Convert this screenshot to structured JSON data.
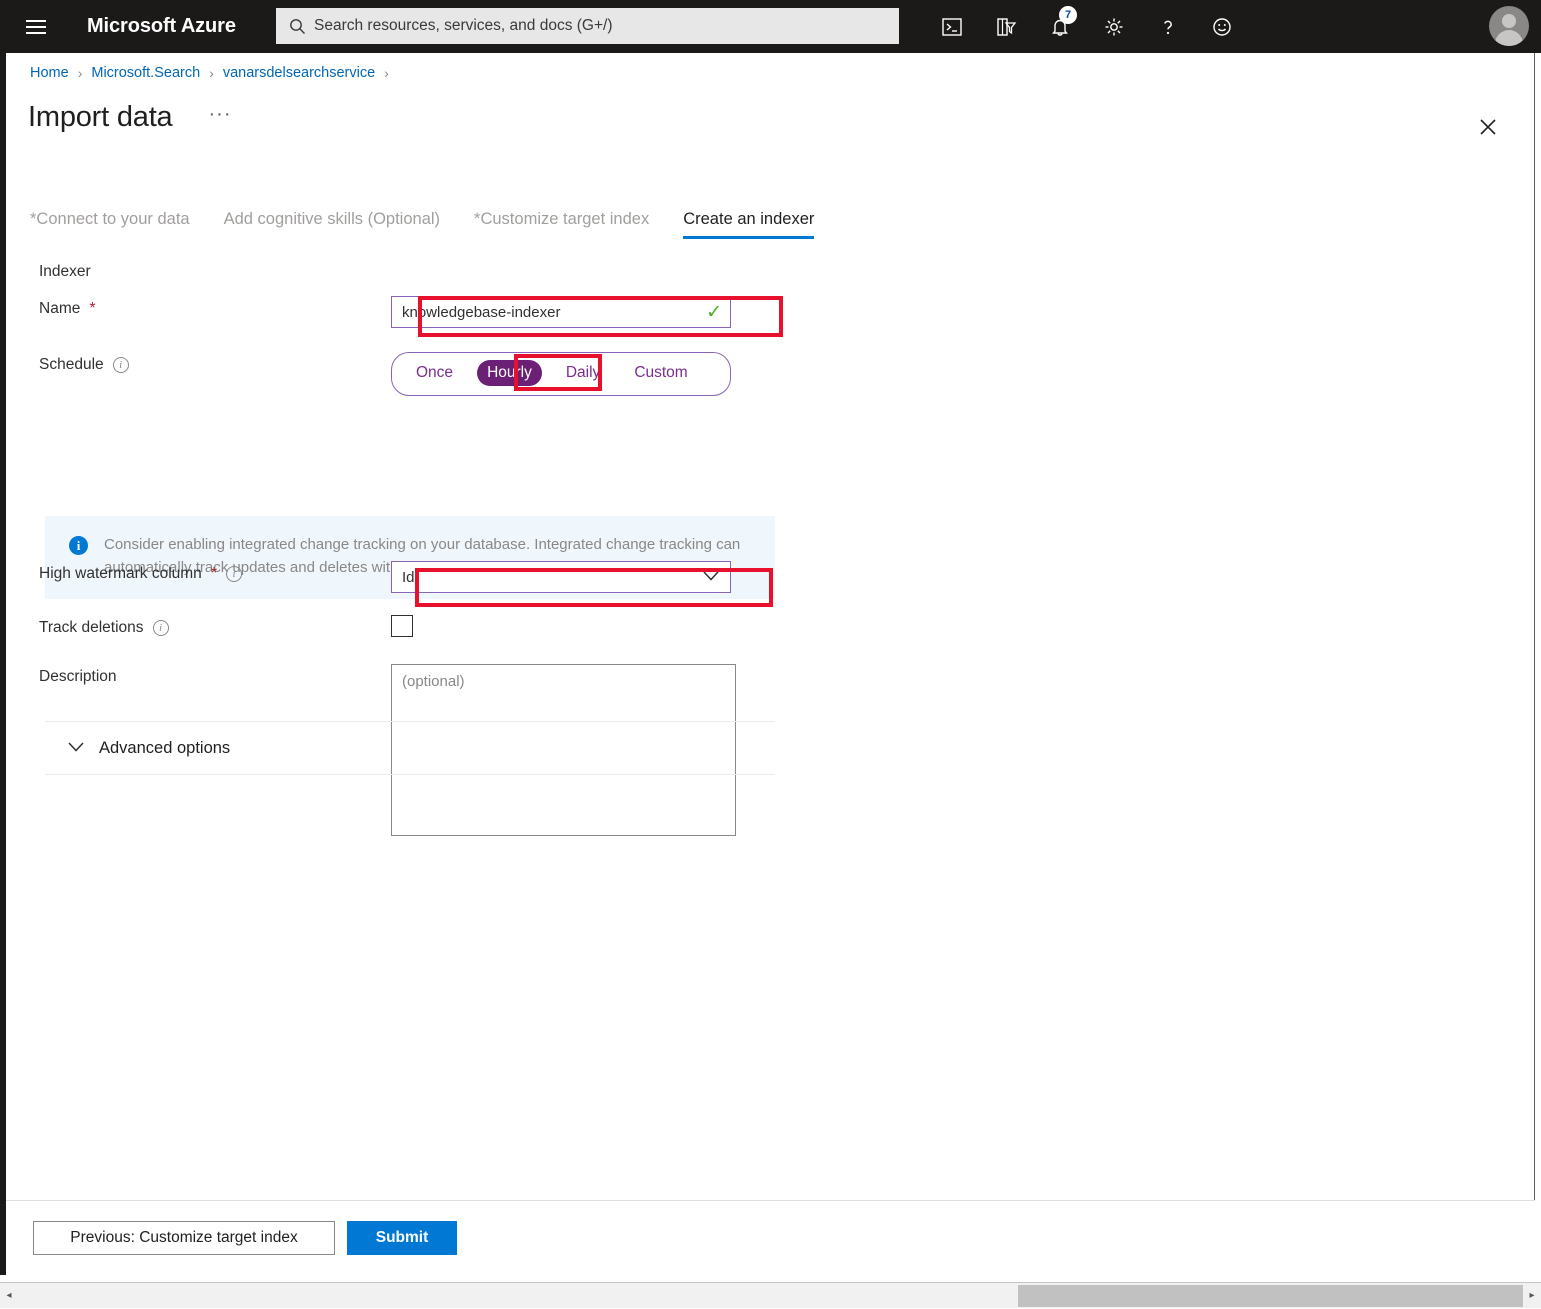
{
  "topbar": {
    "menu_icon": "hamburger-menu-icon",
    "brand": "Microsoft Azure",
    "search_placeholder": "Search resources, services, and docs (G+/)",
    "search_value": "",
    "search_icon": "search-icon",
    "icons": [
      {
        "name": "cloud-shell-icon",
        "glyph": ">_"
      },
      {
        "name": "directory-filter-icon",
        "glyph": ""
      },
      {
        "name": "notifications-bell-icon",
        "glyph": "",
        "badge": "7"
      },
      {
        "name": "settings-gear-icon",
        "glyph": ""
      },
      {
        "name": "help-question-icon",
        "glyph": "?"
      },
      {
        "name": "feedback-smiley-icon",
        "glyph": ""
      }
    ],
    "avatar": "user-avatar"
  },
  "breadcrumb": {
    "items": [
      "Home",
      "Microsoft.Search",
      "vanarsdelsearchservice"
    ],
    "separator": "›",
    "trailing_separator": "›"
  },
  "blade": {
    "title": "Import data",
    "ellipsis": "···",
    "close_label": "✕"
  },
  "tabs": [
    {
      "label": "Connect to your data",
      "required": true,
      "active": false
    },
    {
      "label": "Add cognitive skills (Optional)",
      "required": false,
      "active": false
    },
    {
      "label": "Customize target index",
      "required": true,
      "active": false
    },
    {
      "label": "Create an indexer",
      "required": false,
      "active": true
    }
  ],
  "form": {
    "section_label": "Indexer",
    "name": {
      "label": "Name",
      "required_mark": "*",
      "value": "knowledgebase-indexer",
      "valid_icon": "✓"
    },
    "schedule": {
      "label": "Schedule",
      "info_icon": "i",
      "options": [
        "Once",
        "Hourly",
        "Daily",
        "Custom"
      ],
      "selected": "Hourly"
    },
    "info_banner": {
      "icon": "info-icon",
      "text": "Consider enabling integrated change tracking on your database. Integrated change tracking can automatically track updates and deletes without using marker columns."
    },
    "high_watermark": {
      "label": "High watermark column",
      "required_mark": "*",
      "info_icon": "i",
      "value": "Id",
      "chevron": "⌄"
    },
    "track_deletions": {
      "label": "Track deletions",
      "info_icon": "i",
      "checked": false
    },
    "description": {
      "label": "Description",
      "value": "",
      "placeholder": "(optional)"
    },
    "advanced": {
      "label": "Advanced options",
      "chevron": "⌄",
      "expanded": false
    }
  },
  "footer": {
    "previous_label": "Previous: Customize target index",
    "submit_label": "Submit"
  },
  "scrollbar": {
    "left_arrow": "◂",
    "right_arrow": "▸"
  },
  "colors": {
    "azure_bar": "#1b1a19",
    "accent_blue": "#0078d4",
    "link_blue": "#0067b8",
    "purple_border": "#8764b8",
    "purple_selected": "#6b2076",
    "annotation_red": "#e8112d",
    "valid_green": "#4caf20",
    "info_bg": "#eff6fc",
    "required_red": "#a4262c"
  }
}
